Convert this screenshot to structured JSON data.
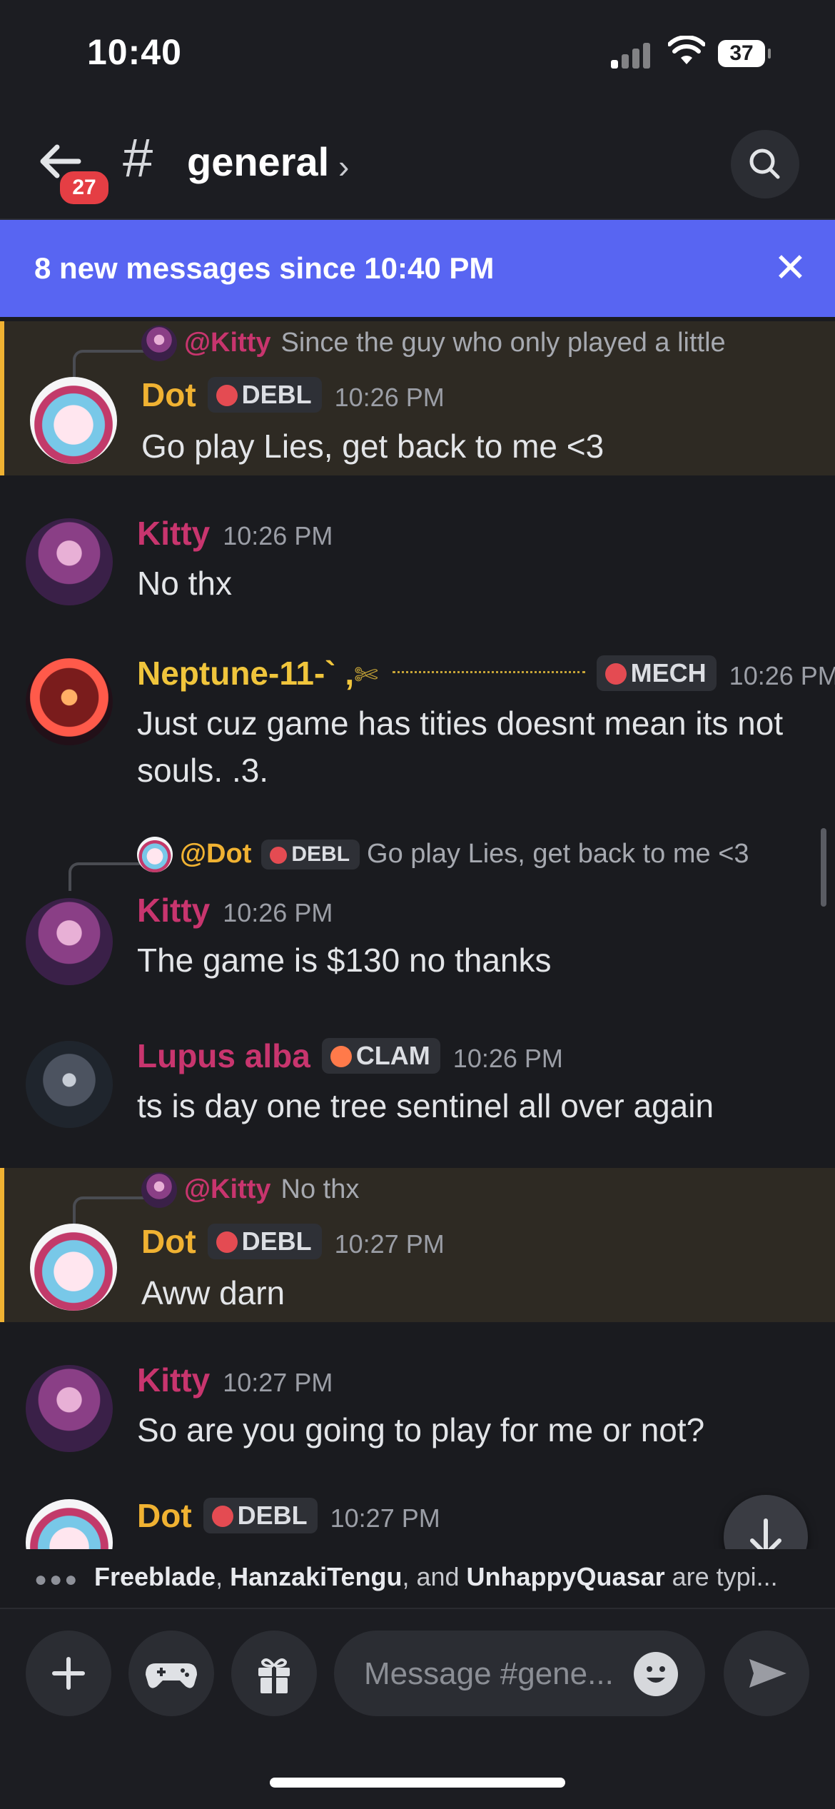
{
  "status_bar": {
    "time": "10:40",
    "battery": "37"
  },
  "header": {
    "back_badge": "27",
    "channel_name": "general"
  },
  "banner": {
    "text": "8 new messages since 10:40 PM"
  },
  "messages": [
    {
      "author": "Dot",
      "role": "DEBL",
      "time": "10:26 PM",
      "reply_to": {
        "name": "@Kitty",
        "text": "Since the guy who only played a little"
      },
      "text": "Go play Lies, get back to me <3"
    },
    {
      "author": "Kitty",
      "time": "10:26 PM",
      "text": "No thx"
    },
    {
      "author": "Neptune-11-` ,",
      "role": "MECH",
      "time": "10:26 PM",
      "text": "Just cuz game has tities doesnt mean its not souls. .3."
    },
    {
      "author": "Kitty",
      "time": "10:26 PM",
      "reply_to": {
        "name": "@Dot",
        "role": "DEBL",
        "text": "Go play Lies, get back to me <3"
      },
      "text": "The game is $130 no thanks"
    },
    {
      "author": "Lupus alba",
      "role": "CLAM",
      "time": "10:26 PM",
      "text": "ts is day one tree sentinel all over again"
    },
    {
      "author": "Dot",
      "role": "DEBL",
      "time": "10:27 PM",
      "reply_to": {
        "name": "@Kitty",
        "text": "No thx"
      },
      "text": "Aww darn"
    },
    {
      "author": "Kitty",
      "time": "10:27 PM",
      "text": "So are you going to play for me or not?"
    },
    {
      "author": "Dot",
      "role": "DEBL",
      "time": "10:27 PM"
    }
  ],
  "typing": {
    "user1": "Freeblade",
    "sep1": ", ",
    "user2": "HanzakiTengu",
    "sep2": ", and ",
    "user3": "UnhappyQuasar",
    "suffix": " are typi..."
  },
  "composer": {
    "placeholder": "Message #gene..."
  },
  "icons": [
    "back-arrow-icon",
    "hash-icon",
    "chevron-right-icon",
    "search-icon",
    "close-icon",
    "chevron-down-icon",
    "plus-icon",
    "gamepad-icon",
    "gift-icon",
    "emoji-icon",
    "send-icon"
  ],
  "colors": {
    "accent": "#5865f2",
    "highlight_border": "#f0b232",
    "dot": "#f0b232",
    "kitty": "#c8356e",
    "neptune": "#f0c53c"
  }
}
